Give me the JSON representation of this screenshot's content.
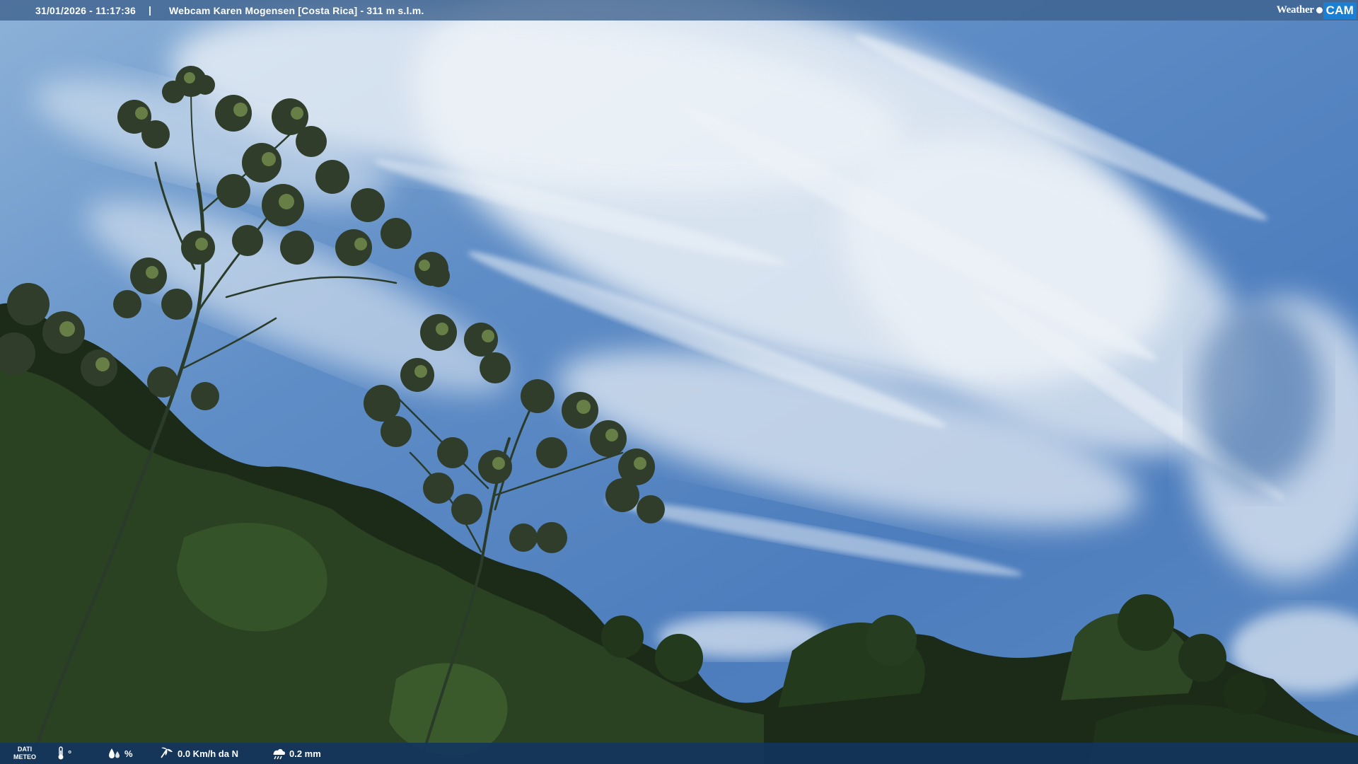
{
  "header": {
    "timestamp": "31/01/2026 - 11:17:36",
    "separator": "|",
    "camera_title": "Webcam Karen Mogensen [Costa Rica] - 311 m s.l.m."
  },
  "logo": {
    "weather": "Weather",
    "cam": "CAM"
  },
  "weather_bar": {
    "label_line1": "DATI",
    "label_line2": "METEO",
    "temperature": "°",
    "humidity": "%",
    "wind": "0.0 Km/h da N",
    "rain": "0.2 mm",
    "icons": [
      "thermometer-icon",
      "humidity-drops-icon",
      "wind-icon",
      "rain-cloud-icon"
    ]
  },
  "colors": {
    "sky_top": "#8fb3d9",
    "sky_mid": "#4f7fbf",
    "clouds": "#eef3f8",
    "foliage_dark": "#1c2b17",
    "foliage_mid": "#31512a",
    "foliage_light": "#6f8e48",
    "top_bar": "#3c608c",
    "bottom_bar": "#123460",
    "logo_blue": "#1d7fd1"
  }
}
